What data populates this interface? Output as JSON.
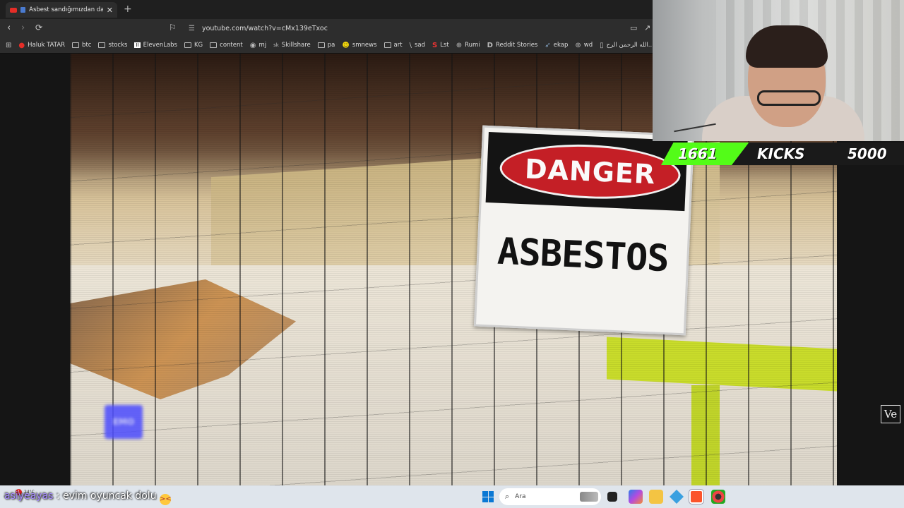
{
  "browser": {
    "tab_title": "Asbest sandığımızdan daha b",
    "close_glyph": "✕",
    "new_tab_glyph": "+",
    "url": "youtube.com/watch?v=cMx139eTxoc",
    "bookmarks": [
      {
        "label": "Haluk TATAR",
        "icon": "youtube-icon"
      },
      {
        "label": "btc",
        "icon": "folder-icon"
      },
      {
        "label": "stocks",
        "icon": "folder-icon"
      },
      {
        "label": "ElevenLabs",
        "icon": "elevenlabs-icon"
      },
      {
        "label": "KG",
        "icon": "folder-icon"
      },
      {
        "label": "content",
        "icon": "folder-icon"
      },
      {
        "label": "mj",
        "icon": "github-icon"
      },
      {
        "label": "Skillshare",
        "icon": "skillshare-icon"
      },
      {
        "label": "pa",
        "icon": "folder-icon"
      },
      {
        "label": "smnews",
        "icon": "smiley-icon"
      },
      {
        "label": "art",
        "icon": "folder-icon"
      },
      {
        "label": "sad",
        "icon": "slash-icon"
      },
      {
        "label": "Lst",
        "icon": "s-logo-icon"
      },
      {
        "label": "Rumi",
        "icon": "globe-icon"
      },
      {
        "label": "Reddit Stories",
        "icon": "d-logo-icon"
      },
      {
        "label": "ekap",
        "icon": "bird-icon"
      },
      {
        "label": "wd",
        "icon": "globe-icon"
      },
      {
        "label": "الله الرحمن الرح...",
        "icon": "document-icon"
      }
    ]
  },
  "video": {
    "sign_top": "DANGER",
    "sign_bottom": "ASBESTOS",
    "blob_text": "EMO",
    "watermark": "Ve"
  },
  "kick_goal": {
    "current": "1661",
    "label": "KICKS",
    "goal": "5000",
    "accent": "#53fc18"
  },
  "taskbar": {
    "weather_badge": "1",
    "weather_temp": "24°C",
    "chat_user": "asiyeayas",
    "chat_message": " : evim oyuncak dolu ",
    "chat_emoji": "😫",
    "search_placeholder": "Ara"
  }
}
